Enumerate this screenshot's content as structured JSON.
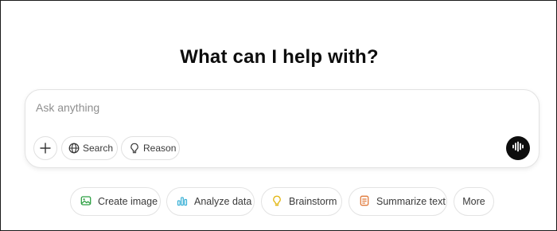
{
  "headline": "What can I help with?",
  "composer": {
    "placeholder": "Ask anything",
    "value": "",
    "buttons": {
      "search_label": "Search",
      "reason_label": "Reason"
    }
  },
  "suggestions": [
    {
      "label": "Create image",
      "icon": "image-icon",
      "color": "#2ea043"
    },
    {
      "label": "Analyze data",
      "icon": "bar-chart-icon",
      "color": "#3ab0d6"
    },
    {
      "label": "Brainstorm",
      "icon": "lightbulb-icon",
      "color": "#e2b714"
    },
    {
      "label": "Summarize text",
      "icon": "document-icon",
      "color": "#e0793a"
    },
    {
      "label": "More",
      "icon": "",
      "color": ""
    }
  ],
  "icons": {
    "plus": "plus-icon",
    "search": "globe-icon",
    "reason": "lightbulb-icon",
    "voice": "voice-waveform-icon"
  },
  "colors": {
    "voice_button_bg": "#0d0d0d",
    "border": "#e3e3e3",
    "placeholder": "#8f8f8f"
  }
}
